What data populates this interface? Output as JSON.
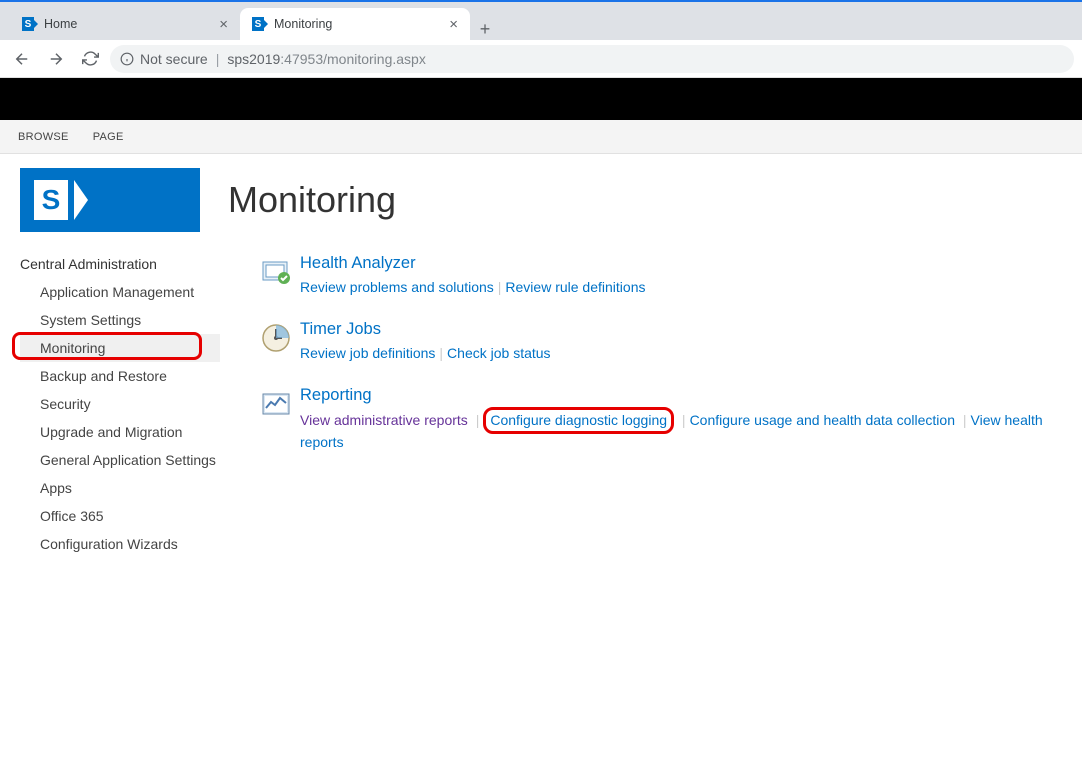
{
  "browser": {
    "tabs": [
      {
        "title": "Home",
        "active": false
      },
      {
        "title": "Monitoring",
        "active": true
      }
    ],
    "address_security": "Not secure",
    "address_host": "sps2019",
    "address_path": ":47953/monitoring.aspx"
  },
  "ribbon": {
    "tabs": [
      "BROWSE",
      "PAGE"
    ]
  },
  "page_title": "Monitoring",
  "sidebar": {
    "header": "Central Administration",
    "items": [
      {
        "label": "Application Management",
        "selected": false
      },
      {
        "label": "System Settings",
        "selected": false
      },
      {
        "label": "Monitoring",
        "selected": true
      },
      {
        "label": "Backup and Restore",
        "selected": false
      },
      {
        "label": "Security",
        "selected": false
      },
      {
        "label": "Upgrade and Migration",
        "selected": false
      },
      {
        "label": "General Application Settings",
        "selected": false
      },
      {
        "label": "Apps",
        "selected": false
      },
      {
        "label": "Office 365",
        "selected": false
      },
      {
        "label": "Configuration Wizards",
        "selected": false
      }
    ]
  },
  "sections": {
    "health": {
      "title": "Health Analyzer",
      "links": [
        "Review problems and solutions",
        "Review rule definitions"
      ]
    },
    "timer": {
      "title": "Timer Jobs",
      "links": [
        "Review job definitions",
        "Check job status"
      ]
    },
    "reporting": {
      "title": "Reporting",
      "links": [
        "View administrative reports",
        "Configure diagnostic logging",
        "Configure usage and health data collection",
        "View health reports"
      ]
    }
  }
}
